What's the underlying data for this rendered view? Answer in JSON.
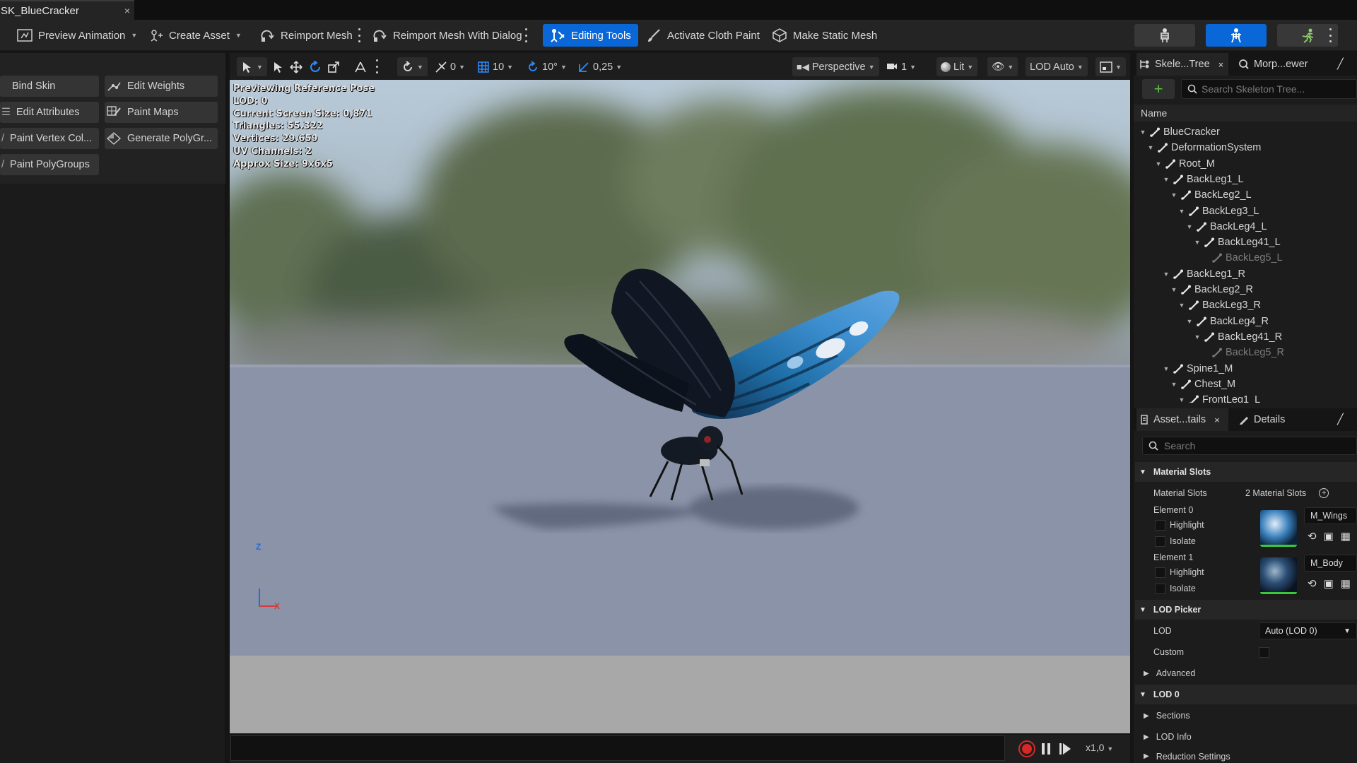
{
  "document_tab": {
    "title": "SK_BlueCracker",
    "close": "×"
  },
  "toolbar": {
    "preview_animation": "Preview Animation",
    "create_asset": "Create Asset",
    "reimport_mesh": "Reimport Mesh",
    "reimport_mesh_dialog": "Reimport Mesh With Dialog",
    "editing_tools": "Editing Tools",
    "activate_cloth_paint": "Activate Cloth Paint",
    "make_static_mesh": "Make Static Mesh"
  },
  "left_panel": {
    "buttons": [
      "Bind Skin",
      "Edit Weights",
      "Edit Attributes",
      "Paint Maps",
      "Paint Vertex Col...",
      "Generate PolyGr...",
      "Paint PolyGroups"
    ]
  },
  "viewport_toolbar": {
    "snap_translate": "0",
    "grid_size": "10",
    "rotation_snap": "10°",
    "scale_snap": "0,25",
    "view_mode": "Perspective",
    "speed": "1",
    "lighting": "Lit",
    "lod": "LOD Auto"
  },
  "viewport_stats": [
    "Previewing Reference Pose",
    "LOD: 0",
    "Current Screen Size: 0,871",
    "Triangles: 55.322",
    "Vertices: 29.659",
    "UV Channels: 2",
    "Approx Size: 9x6x5"
  ],
  "axis": {
    "z": "Z",
    "x": "X"
  },
  "playback": {
    "speed": "x1,0"
  },
  "skeleton_panel": {
    "tabs": [
      "Skele...Tree",
      "Morp...ewer"
    ],
    "search_placeholder": "Search Skeleton Tree...",
    "column": "Name",
    "bones": [
      {
        "name": "BlueCracker",
        "depth": 0,
        "dim": false
      },
      {
        "name": "DeformationSystem",
        "depth": 1,
        "dim": false
      },
      {
        "name": "Root_M",
        "depth": 2,
        "dim": false
      },
      {
        "name": "BackLeg1_L",
        "depth": 3,
        "dim": false
      },
      {
        "name": "BackLeg2_L",
        "depth": 4,
        "dim": false
      },
      {
        "name": "BackLeg3_L",
        "depth": 5,
        "dim": false
      },
      {
        "name": "BackLeg4_L",
        "depth": 6,
        "dim": false
      },
      {
        "name": "BackLeg41_L",
        "depth": 7,
        "dim": false
      },
      {
        "name": "BackLeg5_L",
        "depth": 8,
        "dim": true
      },
      {
        "name": "BackLeg1_R",
        "depth": 3,
        "dim": false
      },
      {
        "name": "BackLeg2_R",
        "depth": 4,
        "dim": false
      },
      {
        "name": "BackLeg3_R",
        "depth": 5,
        "dim": false
      },
      {
        "name": "BackLeg4_R",
        "depth": 6,
        "dim": false
      },
      {
        "name": "BackLeg41_R",
        "depth": 7,
        "dim": false
      },
      {
        "name": "BackLeg5_R",
        "depth": 8,
        "dim": true
      },
      {
        "name": "Spine1_M",
        "depth": 3,
        "dim": false
      },
      {
        "name": "Chest_M",
        "depth": 4,
        "dim": false
      },
      {
        "name": "FrontLeg1_L",
        "depth": 5,
        "dim": false
      }
    ]
  },
  "details_panel": {
    "tabs": [
      "Asset...tails",
      "Details"
    ],
    "search_placeholder": "Search",
    "material_slots_header": "Material Slots",
    "material_slots_label": "Material Slots",
    "material_slots_count": "2 Material Slots",
    "element0": "Element 0",
    "element1": "Element 1",
    "highlight": "Highlight",
    "isolate": "Isolate",
    "material0": "M_Wings",
    "material1": "M_Body",
    "lod_picker_header": "LOD Picker",
    "lod_label": "LOD",
    "lod_value": "Auto (LOD 0)",
    "custom_label": "Custom",
    "advanced": "Advanced",
    "lod0_header": "LOD 0",
    "sections": "Sections",
    "lod_info": "LOD Info",
    "reduction_settings": "Reduction Settings"
  },
  "colors": {
    "accent": "#0a67d8",
    "record": "#d62828"
  }
}
